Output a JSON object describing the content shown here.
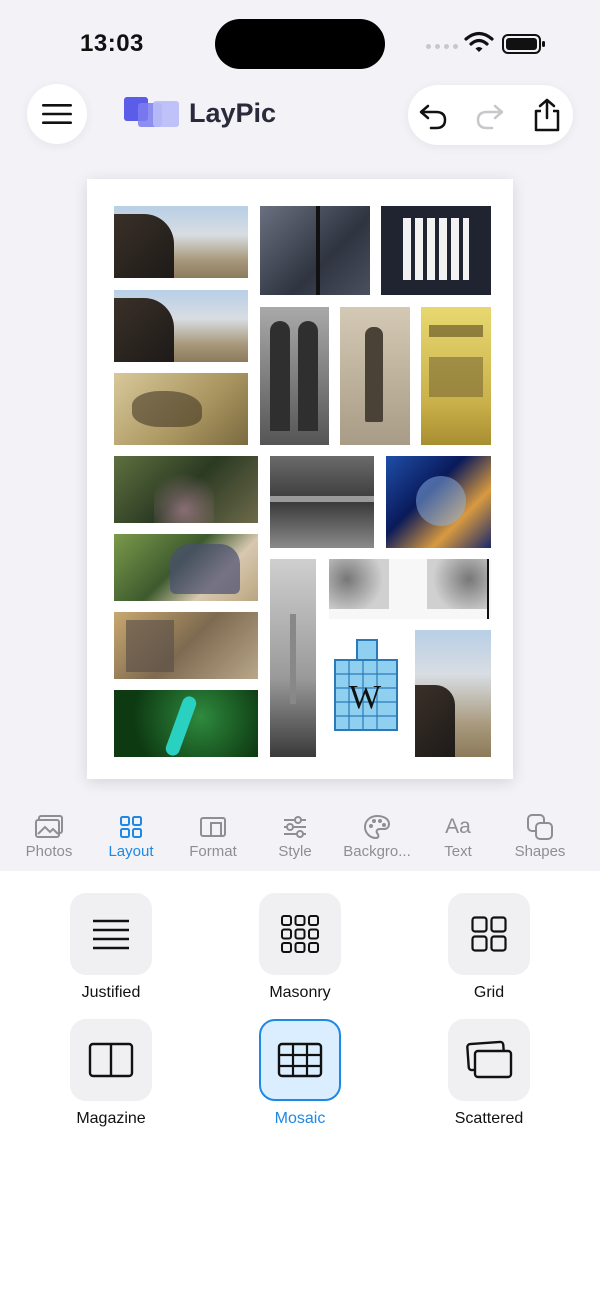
{
  "status_bar": {
    "time": "13:03"
  },
  "header": {
    "app_title": "LayPic"
  },
  "toolbar": {
    "tabs": [
      {
        "label": "Photos",
        "icon": "photos-icon"
      },
      {
        "label": "Layout",
        "icon": "layout-icon",
        "active": true
      },
      {
        "label": "Format",
        "icon": "format-icon"
      },
      {
        "label": "Style",
        "icon": "sliders-icon"
      },
      {
        "label": "Backgro...",
        "icon": "palette-icon"
      },
      {
        "label": "Text",
        "icon": "text-icon",
        "glyph": "Aa"
      },
      {
        "label": "Shapes",
        "icon": "shapes-icon"
      }
    ]
  },
  "layout_options": [
    {
      "label": "Justified",
      "icon": "lines-icon"
    },
    {
      "label": "Masonry",
      "icon": "dot-grid-icon"
    },
    {
      "label": "Grid",
      "icon": "grid-icon"
    },
    {
      "label": "Magazine",
      "icon": "columns-icon"
    },
    {
      "label": "Mosaic",
      "icon": "mosaic-icon",
      "selected": true
    },
    {
      "label": "Scattered",
      "icon": "stacked-cards-icon"
    }
  ],
  "colors": {
    "accent": "#1e88e5",
    "background": "#f2f2f7",
    "tile": "#f0f0f2",
    "selected_tile": "#dbeeff"
  }
}
